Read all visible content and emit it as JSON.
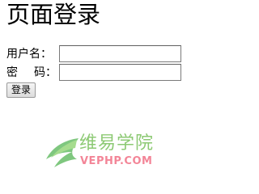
{
  "page": {
    "title": "页面登录"
  },
  "form": {
    "username_label": "用户名：",
    "password_label_first": "密",
    "password_label_last": "码：",
    "username_value": "",
    "password_value": "",
    "submit_label": "登录"
  },
  "watermark": {
    "logo_icon": "leaf-logo-icon",
    "name_cn": "维易学院",
    "name_en": "VEPHP.COM",
    "colors": {
      "cn_text": "#6dbb4d",
      "en_text": "#f0637a",
      "logo": "#5cb85c"
    }
  }
}
